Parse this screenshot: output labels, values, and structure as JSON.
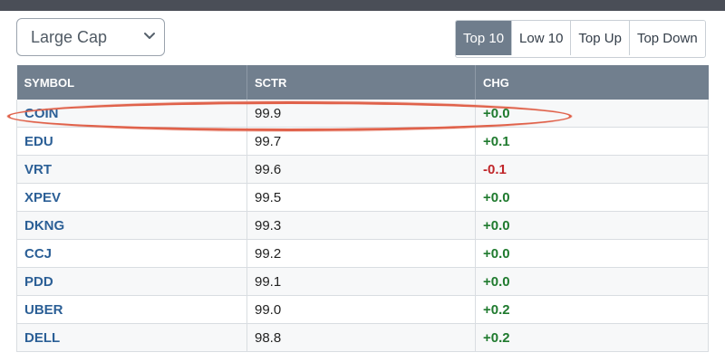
{
  "controls": {
    "cap_select": "Large Cap",
    "buttons": [
      {
        "label": "Top 10",
        "active": true
      },
      {
        "label": "Low 10",
        "active": false
      },
      {
        "label": "Top Up",
        "active": false
      },
      {
        "label": "Top Down",
        "active": false
      }
    ]
  },
  "table": {
    "headers": [
      "SYMBOL",
      "SCTR",
      "CHG"
    ],
    "rows": [
      {
        "symbol": "COIN",
        "sctr": "99.9",
        "chg": "+0.0"
      },
      {
        "symbol": "EDU",
        "sctr": "99.7",
        "chg": "+0.1"
      },
      {
        "symbol": "VRT",
        "sctr": "99.6",
        "chg": "-0.1"
      },
      {
        "symbol": "XPEV",
        "sctr": "99.5",
        "chg": "+0.0"
      },
      {
        "symbol": "DKNG",
        "sctr": "99.3",
        "chg": "+0.0"
      },
      {
        "symbol": "CCJ",
        "sctr": "99.2",
        "chg": "+0.0"
      },
      {
        "symbol": "PDD",
        "sctr": "99.1",
        "chg": "+0.0"
      },
      {
        "symbol": "UBER",
        "sctr": "99.0",
        "chg": "+0.2"
      },
      {
        "symbol": "DELL",
        "sctr": "98.8",
        "chg": "+0.2"
      }
    ]
  },
  "colors": {
    "positive": "#1f7a2e",
    "negative": "#c0262a",
    "highlight": "#e0624b"
  },
  "icons": {
    "select_arrow": "chevron-down-icon"
  }
}
